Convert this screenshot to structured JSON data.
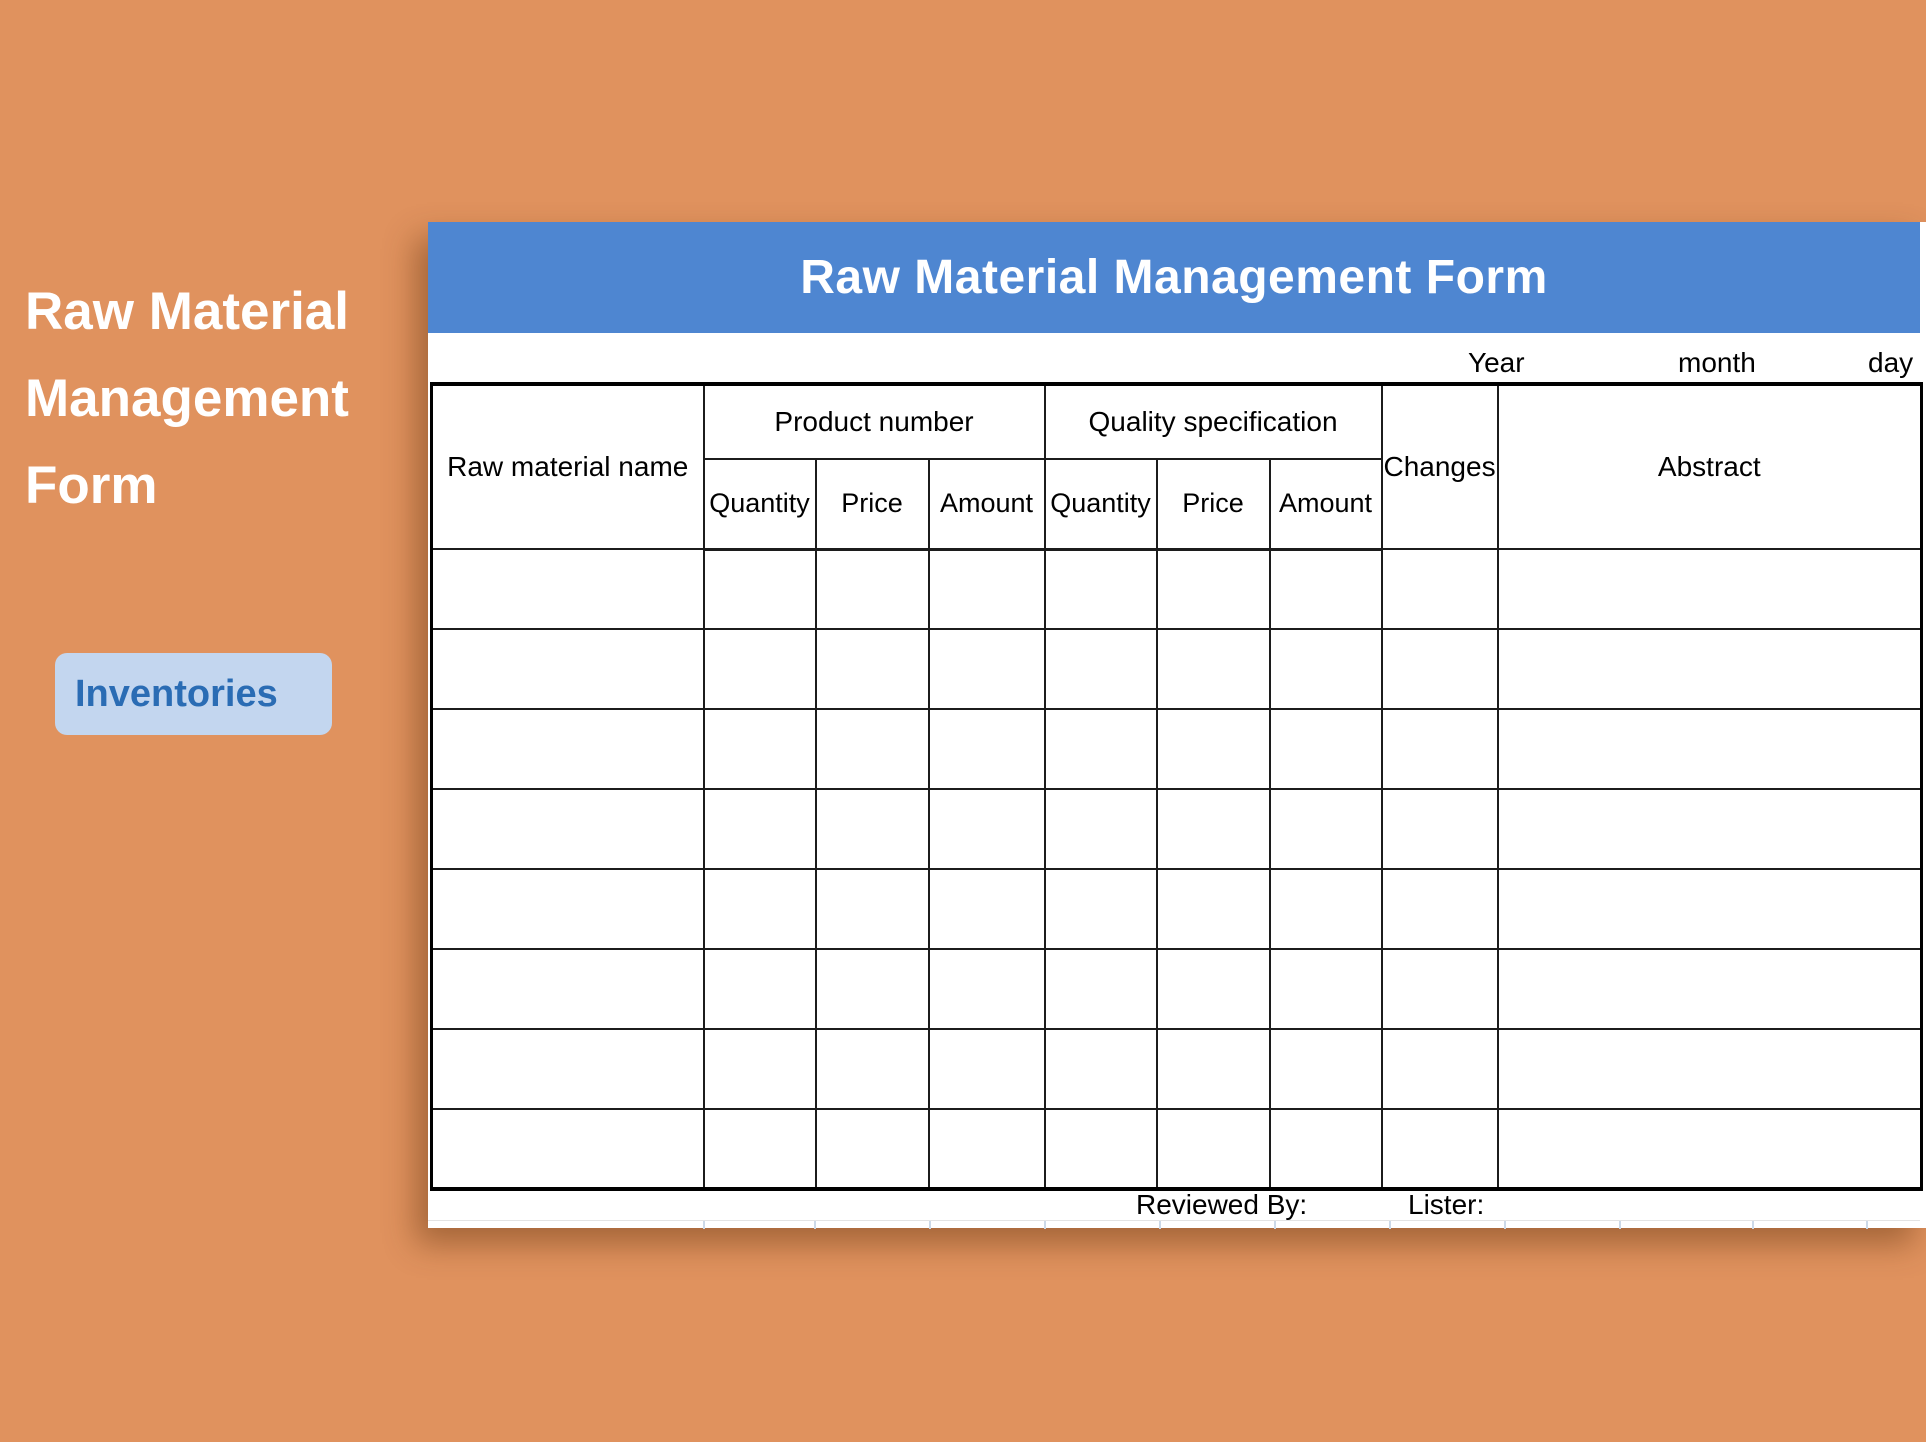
{
  "hero": {
    "title_lines": [
      "Raw Material",
      "Management",
      "Form"
    ],
    "badge_label": "Inventories"
  },
  "sheet": {
    "bar_title": "Raw Material Management Form",
    "date_row": {
      "year": "Year",
      "month": "month",
      "day": "day"
    },
    "table": {
      "col_raw_material": "Raw material name",
      "group_product_number": "Product number",
      "group_quality_spec": "Quality specification",
      "col_changes": "Changes",
      "col_abstract": "Abstract",
      "sub_headers": [
        "Quantity",
        "Price",
        "Amount",
        "Quantity",
        "Price",
        "Amount"
      ],
      "empty_row_count": 8,
      "columns_per_row": 9
    },
    "footer": {
      "reviewed_by": "Reviewed By:",
      "lister": "Lister:"
    }
  },
  "colors": {
    "background": "#e0925e",
    "bar_blue": "#4e86d1",
    "badge_bg": "#c3d6ef",
    "badge_text": "#2a6cb4"
  }
}
